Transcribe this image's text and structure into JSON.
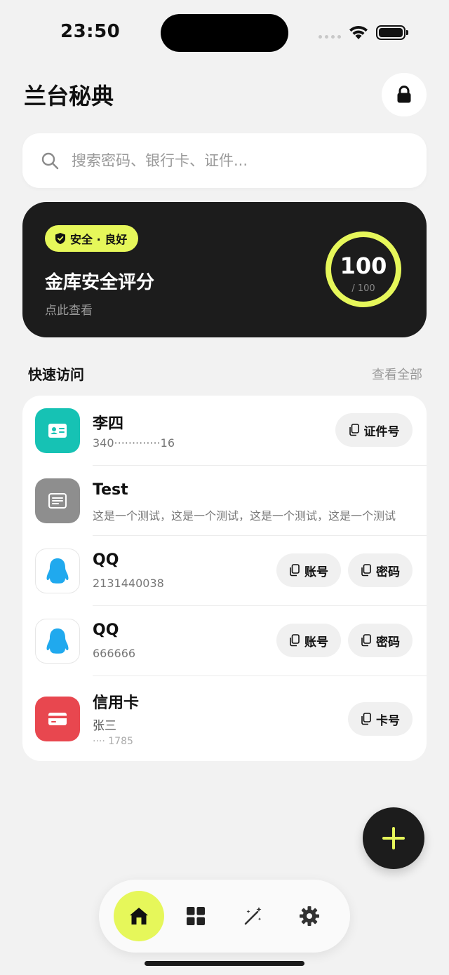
{
  "status_bar": {
    "time": "23:50"
  },
  "header": {
    "title": "兰台秘典"
  },
  "search": {
    "placeholder": "搜索密码、银行卡、证件..."
  },
  "score_card": {
    "badge": "安全 · 良好",
    "title": "金库安全评分",
    "subtitle": "点此查看",
    "score": "100",
    "max": "/ 100",
    "score_fraction": 1.0
  },
  "quick_access": {
    "title": "快速访问",
    "view_all": "查看全部",
    "items": [
      {
        "title": "李四",
        "subtitle": "340·············16",
        "icon": "id-card-icon",
        "buttons": [
          "证件号"
        ]
      },
      {
        "title": "Test",
        "subtitle": "这是一个测试，这是一个测试，这是一个测试，这是一个测试",
        "icon": "note-icon",
        "buttons": []
      },
      {
        "title": "QQ",
        "subtitle": "2131440038",
        "icon": "qq-penguin-icon",
        "buttons": [
          "账号",
          "密码"
        ]
      },
      {
        "title": "QQ",
        "subtitle": "666666",
        "icon": "qq-penguin-icon",
        "buttons": [
          "账号",
          "密码"
        ]
      },
      {
        "title": "信用卡",
        "subtitle": "张三",
        "subtitle2": "···· 1785",
        "icon": "credit-card-icon",
        "buttons": [
          "卡号"
        ]
      }
    ]
  },
  "colors": {
    "accent": "#e6f75a",
    "dark": "#1c1c1c",
    "teal": "#16c2b4",
    "gray": "#8e8e8e",
    "red": "#e8474f",
    "qq_blue": "#20a9ee"
  },
  "tabbar": {
    "tabs": [
      "home-icon",
      "grid-icon",
      "magic-wand-icon",
      "gear-icon"
    ],
    "active": 0
  }
}
